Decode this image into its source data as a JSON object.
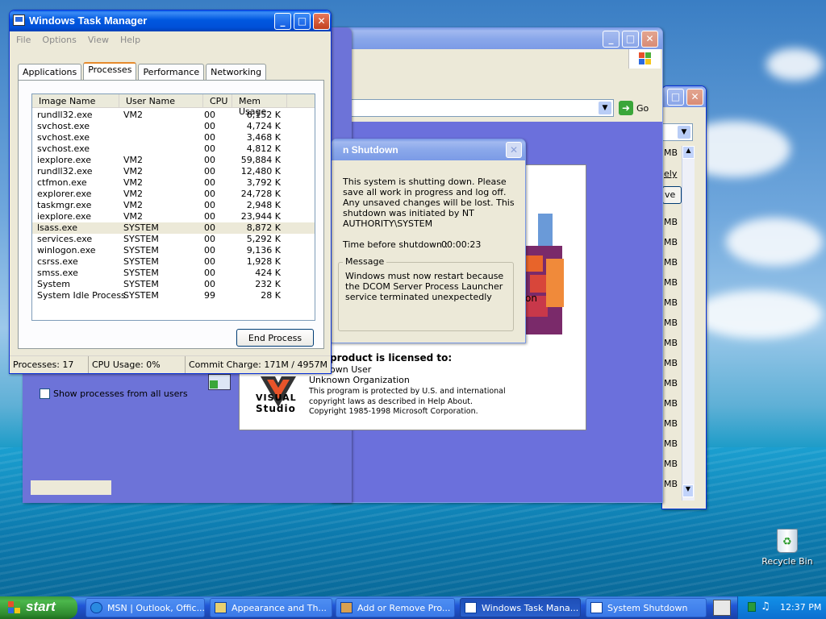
{
  "desktop": {
    "recycle_bin": "Recycle Bin"
  },
  "task_manager": {
    "title": "Windows Task Manager",
    "menu": [
      "File",
      "Options",
      "View",
      "Help"
    ],
    "tabs": [
      "Applications",
      "Processes",
      "Performance",
      "Networking"
    ],
    "active_tab": "Processes",
    "columns": [
      "Image Name",
      "User Name",
      "CPU",
      "Mem Usage"
    ],
    "processes": [
      [
        "rundll32.exe",
        "VM2",
        "00",
        "6,152 K"
      ],
      [
        "svchost.exe",
        "",
        "00",
        "4,724 K"
      ],
      [
        "svchost.exe",
        "",
        "00",
        "3,468 K"
      ],
      [
        "svchost.exe",
        "",
        "00",
        "4,812 K"
      ],
      [
        "iexplore.exe",
        "VM2",
        "00",
        "59,884 K"
      ],
      [
        "rundll32.exe",
        "VM2",
        "00",
        "12,480 K"
      ],
      [
        "ctfmon.exe",
        "VM2",
        "00",
        "3,792 K"
      ],
      [
        "explorer.exe",
        "VM2",
        "00",
        "24,728 K"
      ],
      [
        "taskmgr.exe",
        "VM2",
        "00",
        "2,948 K"
      ],
      [
        "iexplore.exe",
        "VM2",
        "00",
        "23,944 K"
      ],
      [
        "lsass.exe",
        "SYSTEM",
        "00",
        "8,872 K"
      ],
      [
        "services.exe",
        "SYSTEM",
        "00",
        "5,292 K"
      ],
      [
        "winlogon.exe",
        "SYSTEM",
        "00",
        "9,136 K"
      ],
      [
        "csrss.exe",
        "SYSTEM",
        "00",
        "1,928 K"
      ],
      [
        "smss.exe",
        "SYSTEM",
        "00",
        "424 K"
      ],
      [
        "System",
        "SYSTEM",
        "00",
        "232 K"
      ],
      [
        "System Idle Process",
        "SYSTEM",
        "99",
        "28 K"
      ]
    ],
    "show_all_users_label": "Show processes from all users",
    "end_process_label": "End Process",
    "status": {
      "processes": "Processes: 17",
      "cpu": "CPU Usage: 0%",
      "commit": "Commit Charge: 171M / 4957M"
    }
  },
  "browser": {
    "go_label": "Go",
    "partial_heading": "es"
  },
  "side_window": {
    "mb_items": [
      "MB",
      "MB",
      "MB",
      "MB",
      "MB",
      "MB",
      "MB",
      "MB",
      "MB",
      "MB",
      "MB",
      "MB",
      "MB",
      "MB",
      "MB",
      "MB",
      "MB"
    ],
    "partial_link": "ely",
    "partial_button": "ve"
  },
  "shutdown": {
    "title": "n Shutdown",
    "text": "This system is shutting down. Please save all work in progress and log off. Any unsaved changes will be lost. This shutdown was initiated by NT AUTHORITY\\SYSTEM",
    "time_label": "Time before shutdown :",
    "time_value": "00:00:23",
    "message_label": "Message",
    "message": "Windows must now restart because the DCOM Server Process Launcher service terminated unexpectedly"
  },
  "about": {
    "licensed": "product is licensed to:",
    "user": "own User",
    "org": "Unknown Organization",
    "legal1": "This program is protected by U.S. and international",
    "legal2": "copyright laws as described in Help About.",
    "copyright": "Copyright 1985-1998 Microsoft Corporation.",
    "logo_top": "VISUAL",
    "logo_bottom": "Studio",
    "partial": "on"
  },
  "taskbar": {
    "start": "start",
    "buttons": [
      "MSN | Outlook, Offic...",
      "Appearance and Th...",
      "Add or Remove Pro...",
      "Windows Task Mana...",
      "System Shutdown"
    ],
    "clock": "12:37 PM"
  }
}
